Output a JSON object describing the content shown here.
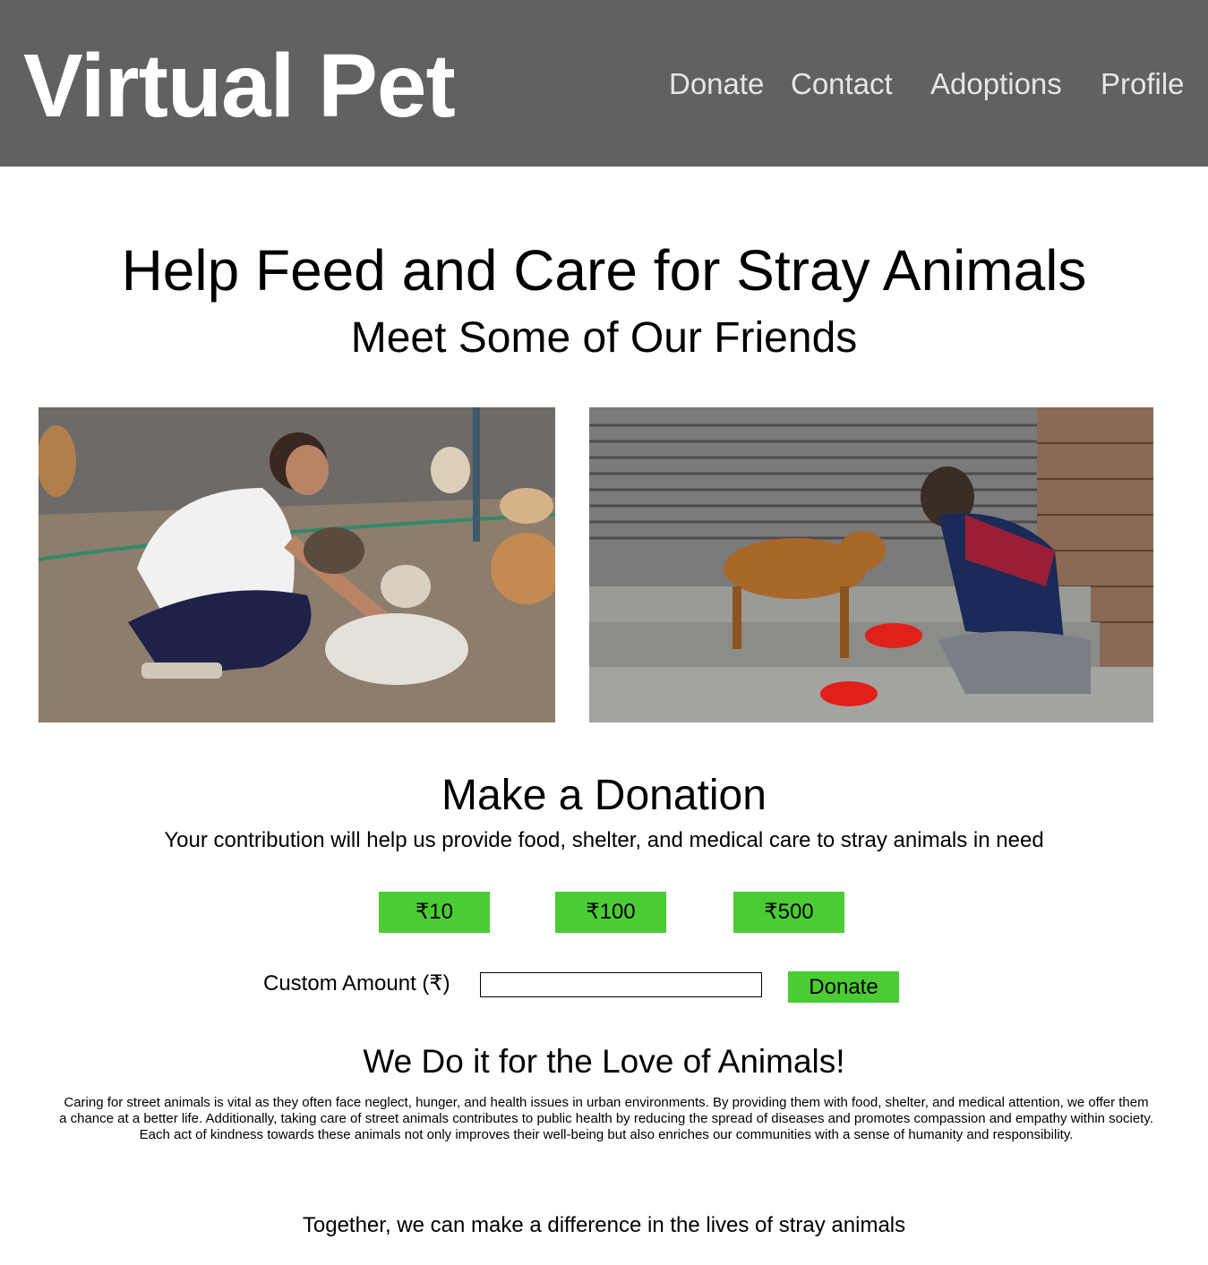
{
  "header": {
    "brand": "Virtual Pet",
    "nav": [
      {
        "label": "Donate"
      },
      {
        "label": "Contact"
      },
      {
        "label": "Adoptions"
      },
      {
        "label": "Profile"
      }
    ]
  },
  "hero": {
    "title": "Help Feed and Care for Stray Animals",
    "subtitle": "Meet Some of Our Friends"
  },
  "donation": {
    "title": "Make a Donation",
    "description": "Your contribution will help us provide food, shelter, and medical care to stray animals in need",
    "amounts": [
      "₹10",
      "₹100",
      "₹500"
    ],
    "custom_label": "Custom Amount (₹)",
    "custom_value": "",
    "custom_placeholder": "",
    "donate_label": "Donate",
    "button_color": "#4ccc34"
  },
  "about": {
    "title": "We Do it for the Love of Animals!",
    "body": "Caring for street animals is vital as they often face neglect, hunger, and health issues in urban environments. By providing them with food, shelter, and medical attention, we offer them a chance at a better life. Additionally, taking care of street animals contributes to public health by reducing the spread of diseases and promotes compassion and empathy within society. Each act of kindness towards these animals not only improves their well-being but also enriches our communities with a sense of humanity and responsibility.",
    "closing": "Together, we can make a difference in the lives of stray animals"
  },
  "colors": {
    "header_bg": "#616161",
    "brand_text": "#ffffff",
    "nav_text": "#e6e6e6",
    "accent_green": "#4ccc34"
  }
}
